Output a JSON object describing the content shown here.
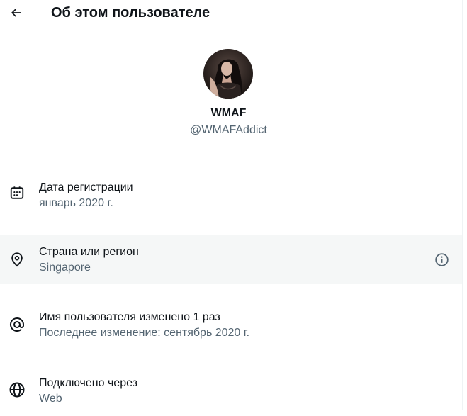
{
  "header": {
    "title": "Об этом пользователе",
    "back_icon": "arrow-left-icon"
  },
  "profile": {
    "display_name": "WMAF",
    "handle": "@WMAFAddict",
    "avatar_icon": "avatar-photo"
  },
  "details": [
    {
      "icon": "calendar-icon",
      "title": "Дата регистрации",
      "value": "январь 2020 г."
    },
    {
      "icon": "location-pin-icon",
      "title": "Страна или регион",
      "value": "Singapore",
      "info_icon": "info-icon"
    },
    {
      "icon": "at-sign-icon",
      "title": "Имя пользователя изменено 1 раз",
      "value": "Последнее изменение: сентябрь 2020 г."
    },
    {
      "icon": "globe-icon",
      "title": "Подключено через",
      "value": "Web"
    }
  ],
  "colors": {
    "text_primary": "#0f1419",
    "text_secondary": "#536471",
    "highlight_row": "#f5f7f7"
  }
}
